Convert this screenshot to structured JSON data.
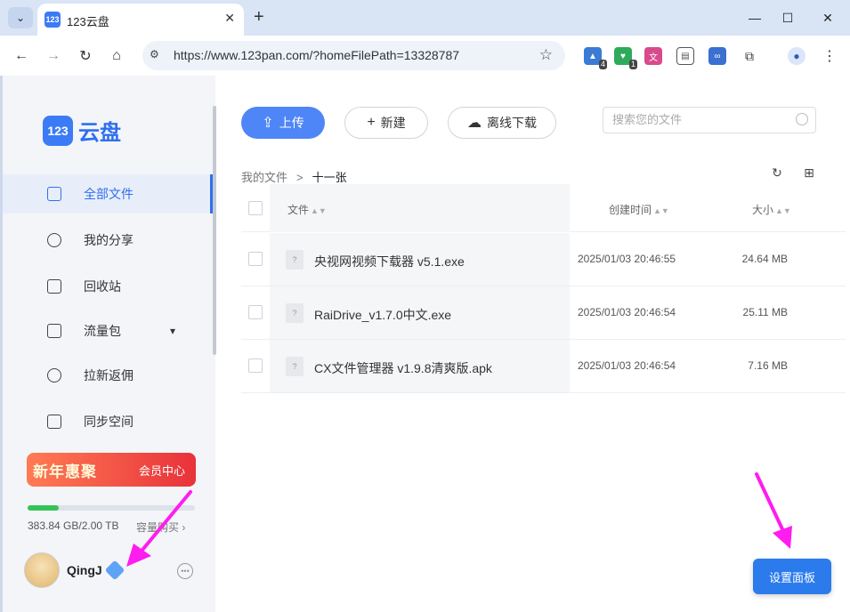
{
  "browser": {
    "tab_title": "123云盘",
    "favicon_text": "123",
    "url": "https://www.123pan.com/?homeFilePath=13328787",
    "extensions": [
      {
        "name": "ext-1",
        "badge": "4",
        "color": "#3a7bd5"
      },
      {
        "name": "ext-2",
        "badge": "1",
        "color": "#2eaa5b"
      },
      {
        "name": "ext-translate",
        "badge": "",
        "color": "#d94a8c"
      },
      {
        "name": "ext-copy",
        "badge": "",
        "color": "#555555"
      },
      {
        "name": "ext-cloud",
        "badge": "",
        "color": "#3b6fd1"
      }
    ]
  },
  "app": {
    "logo_mark": "123",
    "logo_text": "云盘",
    "accent": "#2f6ff0"
  },
  "sidebar": {
    "items": [
      {
        "label": "全部文件",
        "icon": "folder-icon",
        "active": true
      },
      {
        "label": "我的分享",
        "icon": "share-icon",
        "active": false
      },
      {
        "label": "回收站",
        "icon": "trash-icon",
        "active": false
      },
      {
        "label": "流量包",
        "icon": "chart-icon",
        "active": false
      },
      {
        "label": "拉新返佣",
        "icon": "yen-icon",
        "active": false
      },
      {
        "label": "同步空间",
        "icon": "sync-icon",
        "active": false
      }
    ],
    "promo_left": "新年惠聚",
    "promo_right": "会员中心",
    "storage_text": "383.84 GB/2.00 TB",
    "storage_fraction": 0.187,
    "storage_link": "容量购买 ›",
    "username": "QingJ"
  },
  "toolbar": {
    "upload_label": "上传",
    "new_label": "新建",
    "offline_label": "离线下载",
    "search_placeholder": "搜索您的文件"
  },
  "breadcrumb": {
    "root": "我的文件",
    "sep": ">",
    "current": "十一张"
  },
  "table": {
    "columns": [
      "文件",
      "创建时间",
      "大小"
    ],
    "rows": [
      {
        "name": "央视网视频下载器 v5.1.exe",
        "date": "2025/01/03 20:46:55",
        "size": "24.64 MB"
      },
      {
        "name": "RaiDrive_v1.7.0中文.exe",
        "date": "2025/01/03 20:46:54",
        "size": "25.11 MB"
      },
      {
        "name": "CX文件管理器 v1.9.8清爽版.apk",
        "date": "2025/01/03 20:46:54",
        "size": "7.16 MB"
      }
    ]
  },
  "settings_button": "设置面板"
}
